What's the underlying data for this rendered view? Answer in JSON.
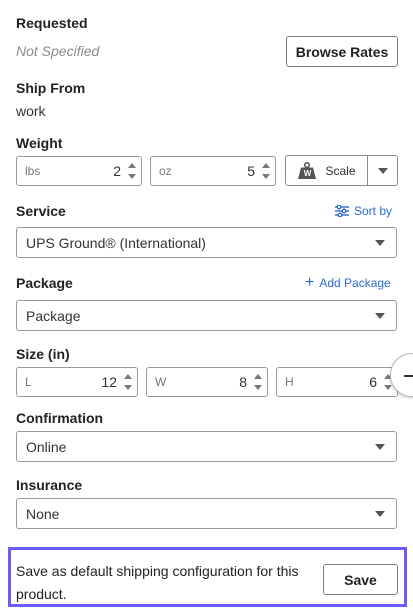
{
  "requested": {
    "label": "Requested",
    "value": "Not Specified",
    "browse_button": "Browse Rates"
  },
  "ship_from": {
    "label": "Ship From",
    "value": "work"
  },
  "weight": {
    "label": "Weight",
    "lbs_unit": "lbs",
    "lbs_value": "2",
    "oz_unit": "oz",
    "oz_value": "5",
    "scale_label": "Scale",
    "scale_icon_letter": "W"
  },
  "service": {
    "label": "Service",
    "sort_link": "Sort by",
    "selected": "UPS Ground® (International)"
  },
  "package": {
    "label": "Package",
    "add_link": "Add Package",
    "selected": "Package"
  },
  "size": {
    "label": "Size (in)",
    "length_unit": "L",
    "length_value": "12",
    "width_unit": "W",
    "width_value": "8",
    "height_unit": "H",
    "height_value": "6"
  },
  "confirmation": {
    "label": "Confirmation",
    "selected": "Online"
  },
  "insurance": {
    "label": "Insurance",
    "selected": "None"
  },
  "footer": {
    "text": "Save as default shipping configuration for this product.",
    "save_button": "Save"
  },
  "colors": {
    "accent_link": "#2a6ccf",
    "highlight_border": "#6a5bff"
  }
}
